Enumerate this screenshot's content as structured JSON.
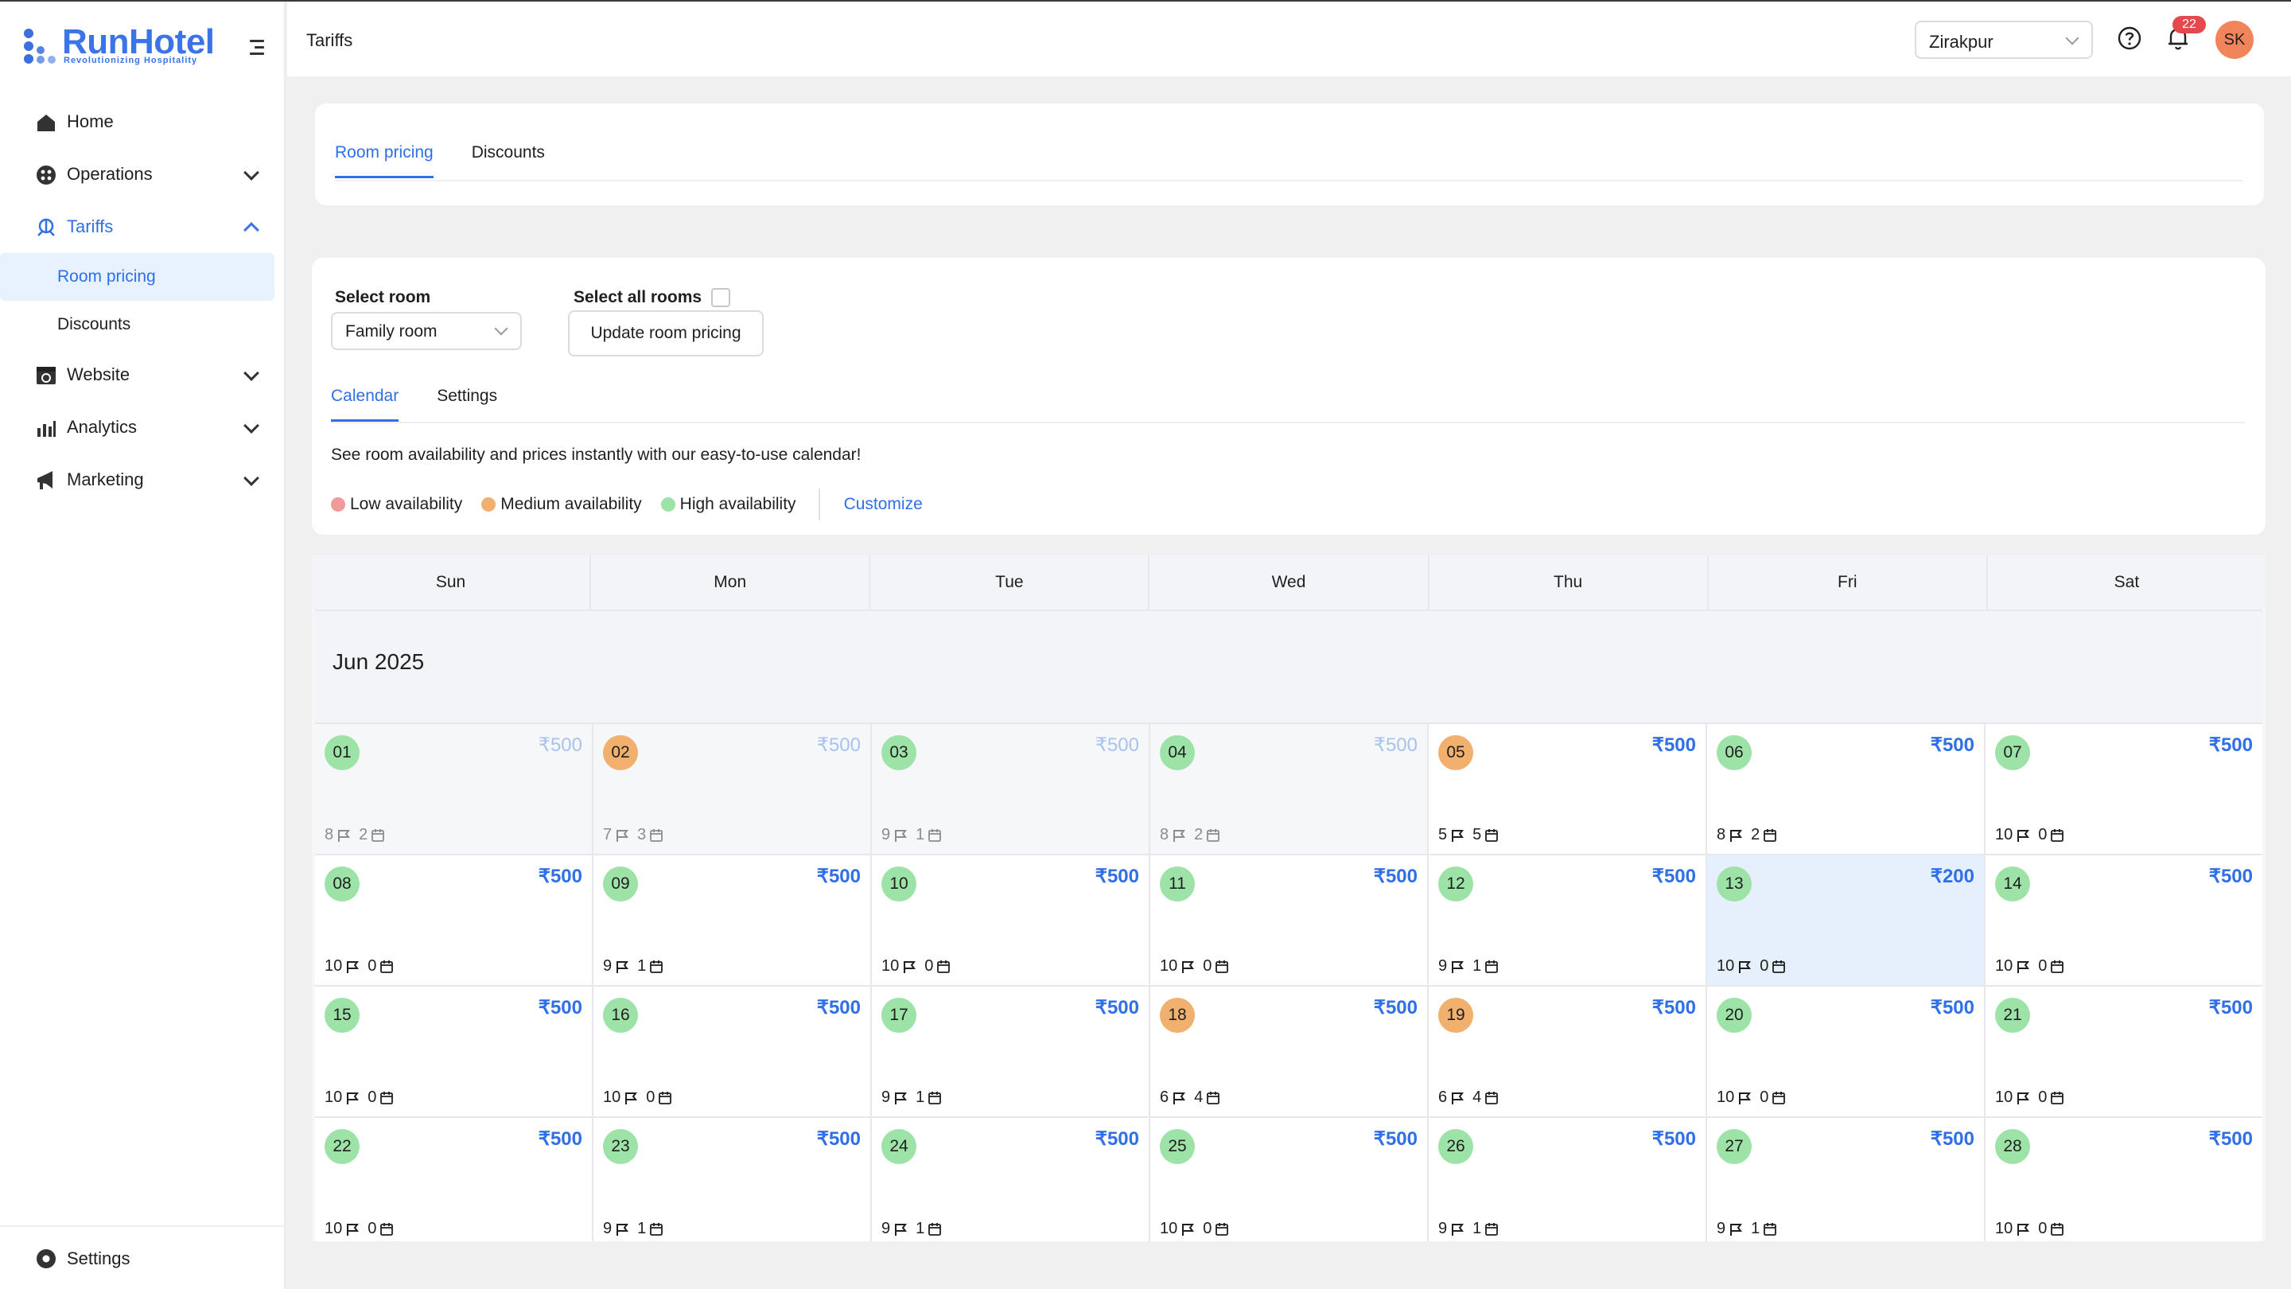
{
  "app": {
    "brand": "RunHotel",
    "tagline": "Revolutionizing Hospitality",
    "page_title": "Tariffs"
  },
  "sidebar": {
    "items": [
      {
        "label": "Home",
        "icon": "home-icon"
      },
      {
        "label": "Operations",
        "icon": "operations-icon"
      },
      {
        "label": "Tariffs",
        "icon": "tariffs-icon"
      },
      {
        "label": "Website",
        "icon": "website-icon"
      },
      {
        "label": "Analytics",
        "icon": "analytics-icon"
      },
      {
        "label": "Marketing",
        "icon": "megaphone-icon"
      }
    ],
    "sub_items": [
      "Room pricing",
      "Discounts"
    ],
    "footer_label": "Settings"
  },
  "header": {
    "location": "Zirakpur",
    "notification_count": "22",
    "avatar_initials": "SK"
  },
  "top_tabs": [
    "Room pricing",
    "Discounts"
  ],
  "controls": {
    "select_room_label": "Select room",
    "room_value": "Family room",
    "select_all_label": "Select all rooms",
    "update_button": "Update room pricing"
  },
  "inner_tabs": [
    "Calendar",
    "Settings"
  ],
  "description": "See room availability and prices instantly with our easy-to-use calendar!",
  "legend": {
    "low": "Low availability",
    "medium": "Medium availability",
    "high": "High availability",
    "customize": "Customize",
    "colors": {
      "low": "#f19a9a",
      "medium": "#f2b06e",
      "high": "#9de3a8",
      "accent": "#2f6fe8"
    }
  },
  "calendar": {
    "weekdays": [
      "Sun",
      "Mon",
      "Tue",
      "Wed",
      "Thu",
      "Fri",
      "Sat"
    ],
    "month": "Jun 2025",
    "weeks": [
      [
        {
          "day": "01",
          "price": "₹500",
          "avail": "high",
          "a": "8",
          "b": "2",
          "past": true
        },
        {
          "day": "02",
          "price": "₹500",
          "avail": "medium",
          "a": "7",
          "b": "3",
          "past": true
        },
        {
          "day": "03",
          "price": "₹500",
          "avail": "high",
          "a": "9",
          "b": "1",
          "past": true
        },
        {
          "day": "04",
          "price": "₹500",
          "avail": "high",
          "a": "8",
          "b": "2",
          "past": true
        },
        {
          "day": "05",
          "price": "₹500",
          "avail": "medium",
          "a": "5",
          "b": "5"
        },
        {
          "day": "06",
          "price": "₹500",
          "avail": "high",
          "a": "8",
          "b": "2"
        },
        {
          "day": "07",
          "price": "₹500",
          "avail": "high",
          "a": "10",
          "b": "0"
        }
      ],
      [
        {
          "day": "08",
          "price": "₹500",
          "avail": "high",
          "a": "10",
          "b": "0"
        },
        {
          "day": "09",
          "price": "₹500",
          "avail": "high",
          "a": "9",
          "b": "1"
        },
        {
          "day": "10",
          "price": "₹500",
          "avail": "high",
          "a": "10",
          "b": "0"
        },
        {
          "day": "11",
          "price": "₹500",
          "avail": "high",
          "a": "10",
          "b": "0"
        },
        {
          "day": "12",
          "price": "₹500",
          "avail": "high",
          "a": "9",
          "b": "1"
        },
        {
          "day": "13",
          "price": "₹200",
          "avail": "high",
          "a": "10",
          "b": "0",
          "selected": true
        },
        {
          "day": "14",
          "price": "₹500",
          "avail": "high",
          "a": "10",
          "b": "0"
        }
      ],
      [
        {
          "day": "15",
          "price": "₹500",
          "avail": "high",
          "a": "10",
          "b": "0"
        },
        {
          "day": "16",
          "price": "₹500",
          "avail": "high",
          "a": "10",
          "b": "0"
        },
        {
          "day": "17",
          "price": "₹500",
          "avail": "high",
          "a": "9",
          "b": "1"
        },
        {
          "day": "18",
          "price": "₹500",
          "avail": "medium",
          "a": "6",
          "b": "4"
        },
        {
          "day": "19",
          "price": "₹500",
          "avail": "medium",
          "a": "6",
          "b": "4"
        },
        {
          "day": "20",
          "price": "₹500",
          "avail": "high",
          "a": "10",
          "b": "0"
        },
        {
          "day": "21",
          "price": "₹500",
          "avail": "high",
          "a": "10",
          "b": "0"
        }
      ],
      [
        {
          "day": "22",
          "price": "₹500",
          "avail": "high",
          "a": "10",
          "b": "0"
        },
        {
          "day": "23",
          "price": "₹500",
          "avail": "high",
          "a": "9",
          "b": "1"
        },
        {
          "day": "24",
          "price": "₹500",
          "avail": "high",
          "a": "9",
          "b": "1"
        },
        {
          "day": "25",
          "price": "₹500",
          "avail": "high",
          "a": "10",
          "b": "0"
        },
        {
          "day": "26",
          "price": "₹500",
          "avail": "high",
          "a": "9",
          "b": "1"
        },
        {
          "day": "27",
          "price": "₹500",
          "avail": "high",
          "a": "9",
          "b": "1"
        },
        {
          "day": "28",
          "price": "₹500",
          "avail": "high",
          "a": "10",
          "b": "0"
        }
      ]
    ]
  }
}
